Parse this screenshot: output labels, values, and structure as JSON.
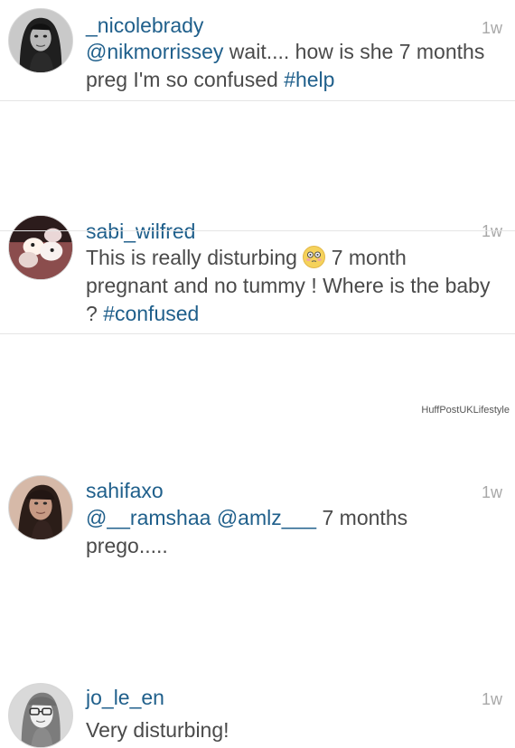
{
  "comments": [
    {
      "username": "_nicolebrady",
      "timestamp": "1w",
      "avatar": "avatar-nicolebrady",
      "text": {
        "mention_1": "@nikmorrissey",
        "part_1": " wait.... how is she 7 months preg I'm so confused ",
        "hashtag_1": "#help"
      }
    },
    {
      "username": "sabi_wilfred",
      "timestamp": "1w",
      "avatar": "avatar-sabiwilfred",
      "text": {
        "part_1": "This is really disturbing ",
        "emoji_1": "flushed-face-emoji",
        "part_2": " 7 month pregnant and no tummy ! Where is the baby ? ",
        "hashtag_1": "#confused"
      }
    },
    {
      "username": "sahifaxo",
      "timestamp": "1w",
      "avatar": "avatar-sahifaxo",
      "text": {
        "mention_1": "@__ramshaa",
        "part_1": " ",
        "mention_2": "@amlz___",
        "part_2": " 7 months prego....."
      }
    },
    {
      "username": "jo_le_en",
      "timestamp": "1w",
      "avatar": "avatar-jo_le_en",
      "text": {
        "part_1": "Very disturbing!"
      }
    }
  ],
  "watermark": "HuffPostUKLifestyle",
  "colors": {
    "username": "#1f5f8b",
    "body": "#4a4a4a",
    "timestamp": "#a8a8a8",
    "divider": "#e5e5e5"
  }
}
